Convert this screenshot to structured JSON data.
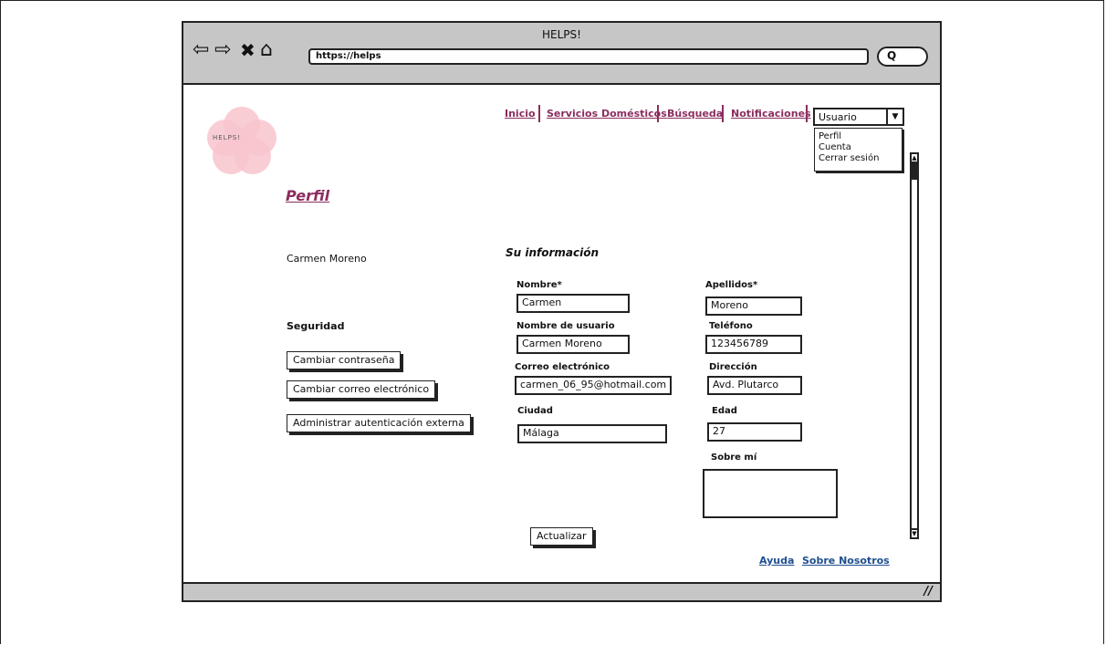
{
  "browser": {
    "title": "HELPS!",
    "url": "https://helps",
    "nav_icons": [
      "back-icon",
      "forward-icon",
      "stop-icon",
      "home-icon"
    ],
    "search_icon": "magnifier-icon"
  },
  "logo": {
    "name": "HELPS!",
    "colors": {
      "petal": "#f8c4cd"
    }
  },
  "topnav": {
    "items": [
      "Inicio",
      "Servicios Domésticos",
      "Búsqueda",
      "Notificaciones"
    ],
    "color": "#8b2d5e"
  },
  "user_menu": {
    "selected": "Usuario",
    "options": [
      "Perfil",
      "Cuenta",
      "Cerrar sesión"
    ]
  },
  "page": {
    "title": "Perfil",
    "username": "Carmen Moreno"
  },
  "security": {
    "heading": "Seguridad",
    "buttons": [
      "Cambiar contraseña",
      "Cambiar correo electrónico",
      "Administrar autenticación externa"
    ]
  },
  "info": {
    "heading": "Su información",
    "nombre_label": "Nombre*",
    "nombre": "Carmen",
    "apellidos_label": "Apellidos*",
    "apellidos": "Moreno",
    "usuario_label": "Nombre de usuario",
    "usuario": "Carmen Moreno",
    "telefono_label": "Teléfono",
    "telefono": "123456789",
    "correo_label": "Correo electrónico",
    "correo": "carmen_06_95@hotmail.com",
    "direccion_label": "Dirección",
    "direccion": "Avd. Plutarco",
    "ciudad_label": "Ciudad",
    "ciudad": "Málaga",
    "edad_label": "Edad",
    "edad": "27",
    "sobre_label": "Sobre mí",
    "sobre": ""
  },
  "actions": {
    "update": "Actualizar"
  },
  "footer": {
    "links": [
      "Ayuda",
      "Sobre Nosotros"
    ],
    "color": "#1e4f8f"
  }
}
